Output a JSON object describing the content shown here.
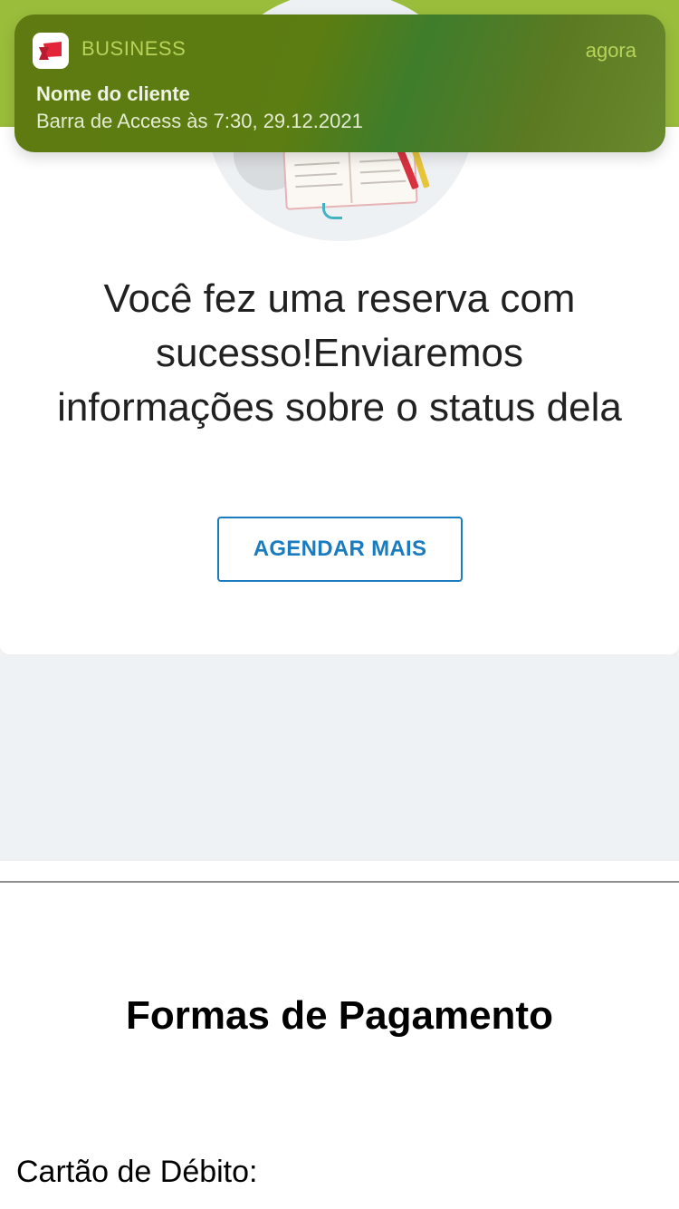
{
  "notification": {
    "app_name": "BUSINESS",
    "time": "agora",
    "title": "Nome do cliente",
    "body": "Barra de Access às 7:30, 29.12.2021",
    "icon": "business-app-logo-icon"
  },
  "success": {
    "message": "Você fez uma reserva com sucesso!Enviaremos informações sobre o status dela",
    "button_label": "AGENDAR MAIS"
  },
  "payments": {
    "title": "Formas de Pagamento",
    "debit_label": "Cartão de Débito:"
  },
  "colors": {
    "header_green": "#9bbd3c",
    "accent_blue": "#1a7bbf",
    "notification_green": "#5e7a10",
    "gray_background": "#eff2f5"
  }
}
